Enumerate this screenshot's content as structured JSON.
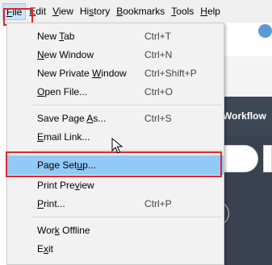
{
  "menubar": {
    "items": [
      {
        "pre": "",
        "key": "F",
        "post": "ile"
      },
      {
        "pre": "",
        "key": "E",
        "post": "dit"
      },
      {
        "pre": "",
        "key": "V",
        "post": "iew"
      },
      {
        "pre": "Hi",
        "key": "s",
        "post": "tory"
      },
      {
        "pre": "",
        "key": "B",
        "post": "ookmarks"
      },
      {
        "pre": "",
        "key": "T",
        "post": "ools"
      },
      {
        "pre": "",
        "key": "H",
        "post": "elp"
      }
    ]
  },
  "background": {
    "workflow_label": "Workflow"
  },
  "file_menu": {
    "items": [
      {
        "pre": "New ",
        "key": "T",
        "post": "ab",
        "shortcut": "Ctrl+T"
      },
      {
        "pre": "",
        "key": "N",
        "post": "ew Window",
        "shortcut": "Ctrl+N"
      },
      {
        "pre": "New Private ",
        "key": "W",
        "post": "indow",
        "shortcut": "Ctrl+Shift+P"
      },
      {
        "pre": "",
        "key": "O",
        "post": "pen File...",
        "shortcut": "Ctrl+O"
      },
      {
        "pre": "Save Page ",
        "key": "A",
        "post": "s...",
        "shortcut": "Ctrl+S"
      },
      {
        "pre": "",
        "key": "E",
        "post": "mail Link...",
        "shortcut": ""
      },
      {
        "pre": "Page Set",
        "key": "u",
        "post": "p...",
        "shortcut": ""
      },
      {
        "pre": "Print Pre",
        "key": "v",
        "post": "iew",
        "shortcut": ""
      },
      {
        "pre": "",
        "key": "P",
        "post": "rint...",
        "shortcut": "Ctrl+P"
      },
      {
        "pre": "Wor",
        "key": "k",
        "post": " Offline",
        "shortcut": ""
      },
      {
        "pre": "E",
        "key": "x",
        "post": "it",
        "shortcut": ""
      }
    ]
  },
  "colors": {
    "highlight": "#91c9f7",
    "annotation_red": "#e0262b"
  }
}
